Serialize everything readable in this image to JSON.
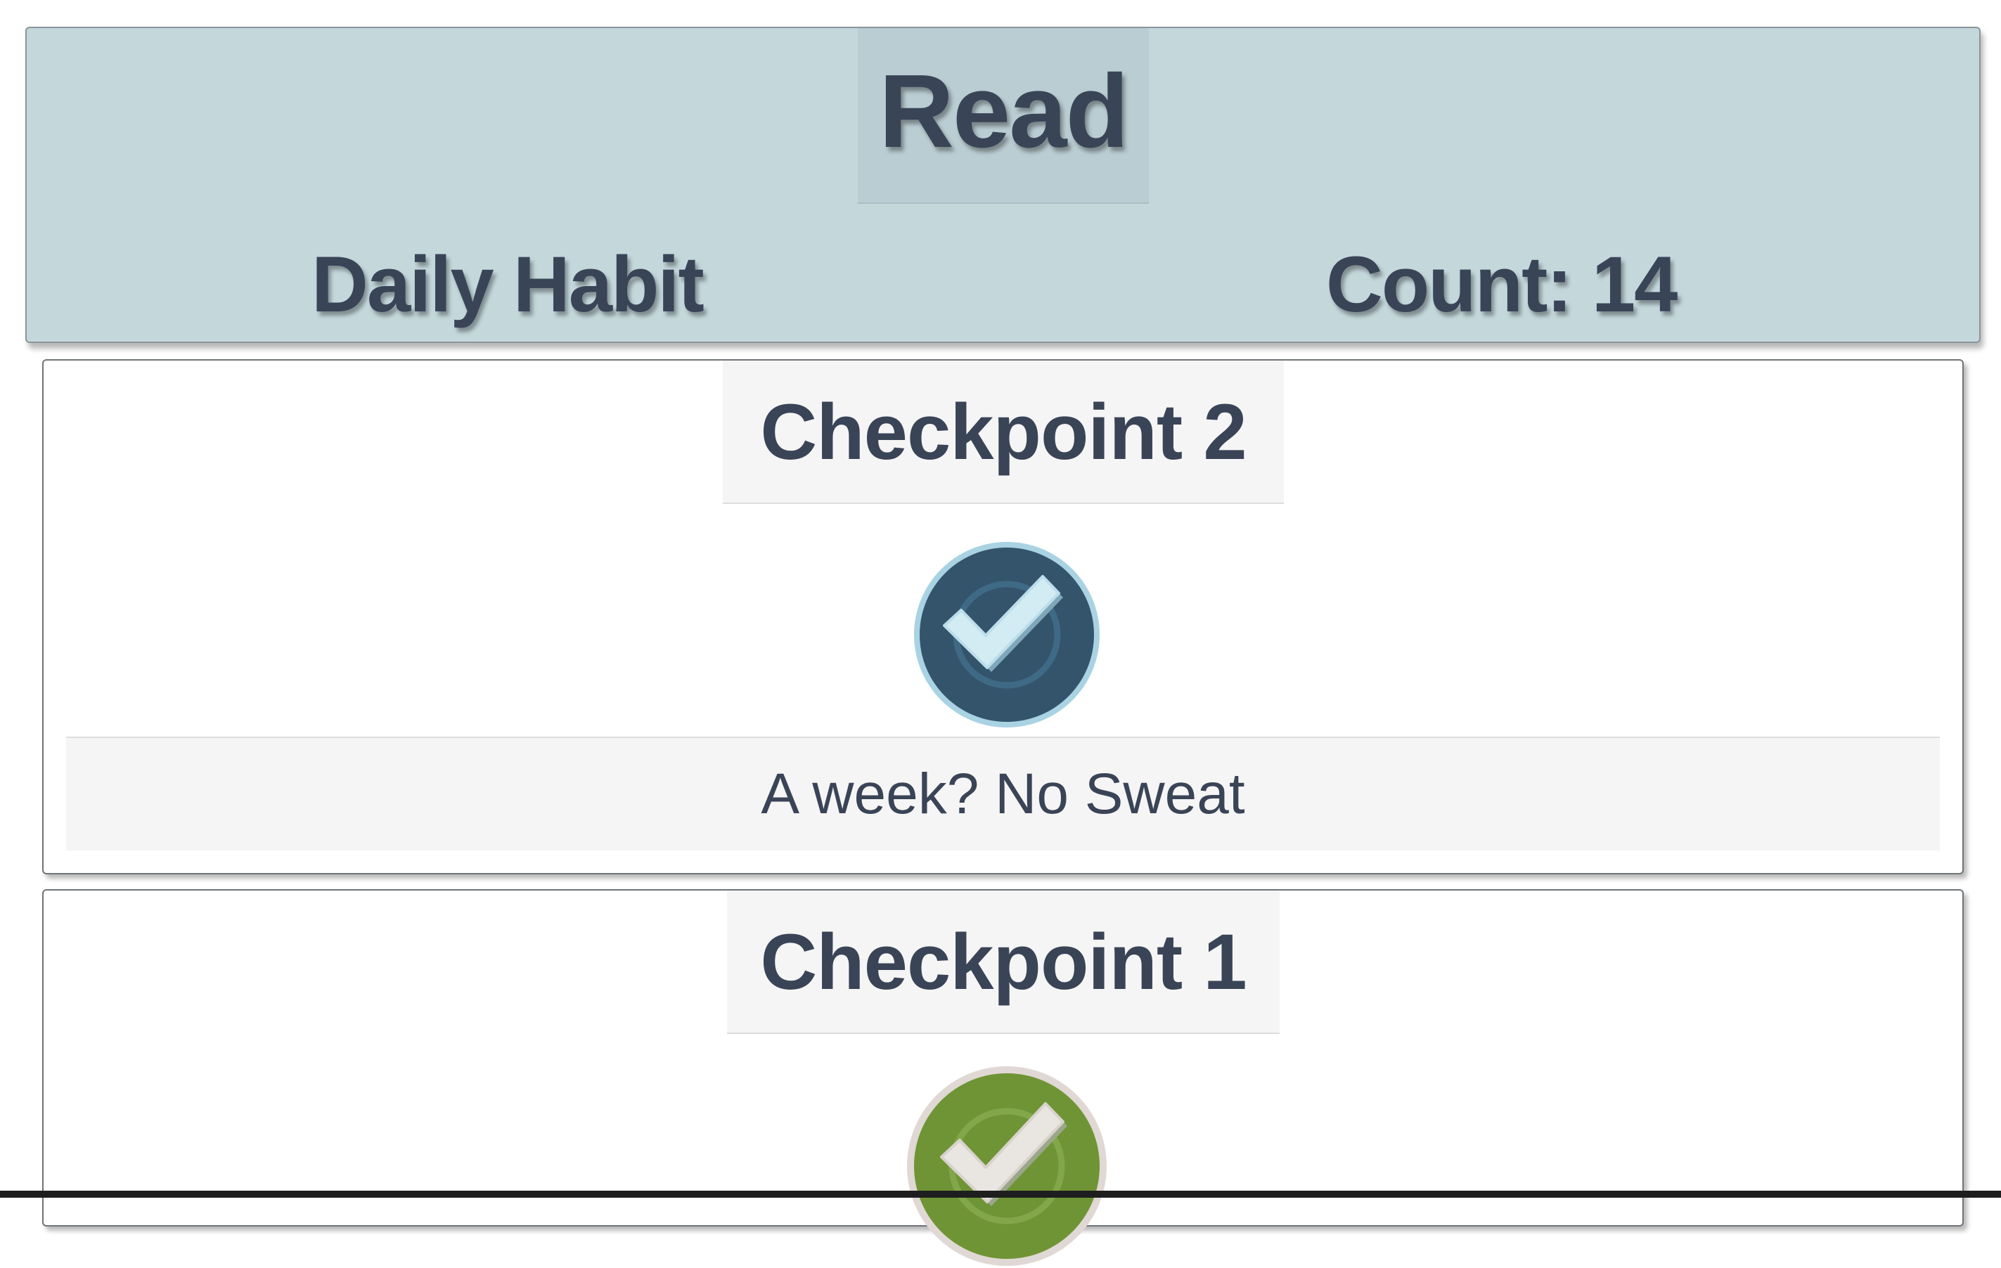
{
  "habit": {
    "title": "Read",
    "type": "Daily Habit",
    "count": "Count: 14",
    "background_color": "#c4d8dc",
    "text_color": "#3a4457"
  },
  "checkpoints": [
    {
      "title": "Checkpoint 2",
      "badge_icon": "checkmark-badge-icon",
      "badge_color": "#34546c",
      "caption": "A week? No Sweat"
    },
    {
      "title": "Checkpoint 1",
      "badge_icon": "checkmark-badge-icon",
      "badge_color": "#6f9435",
      "caption": ""
    }
  ]
}
